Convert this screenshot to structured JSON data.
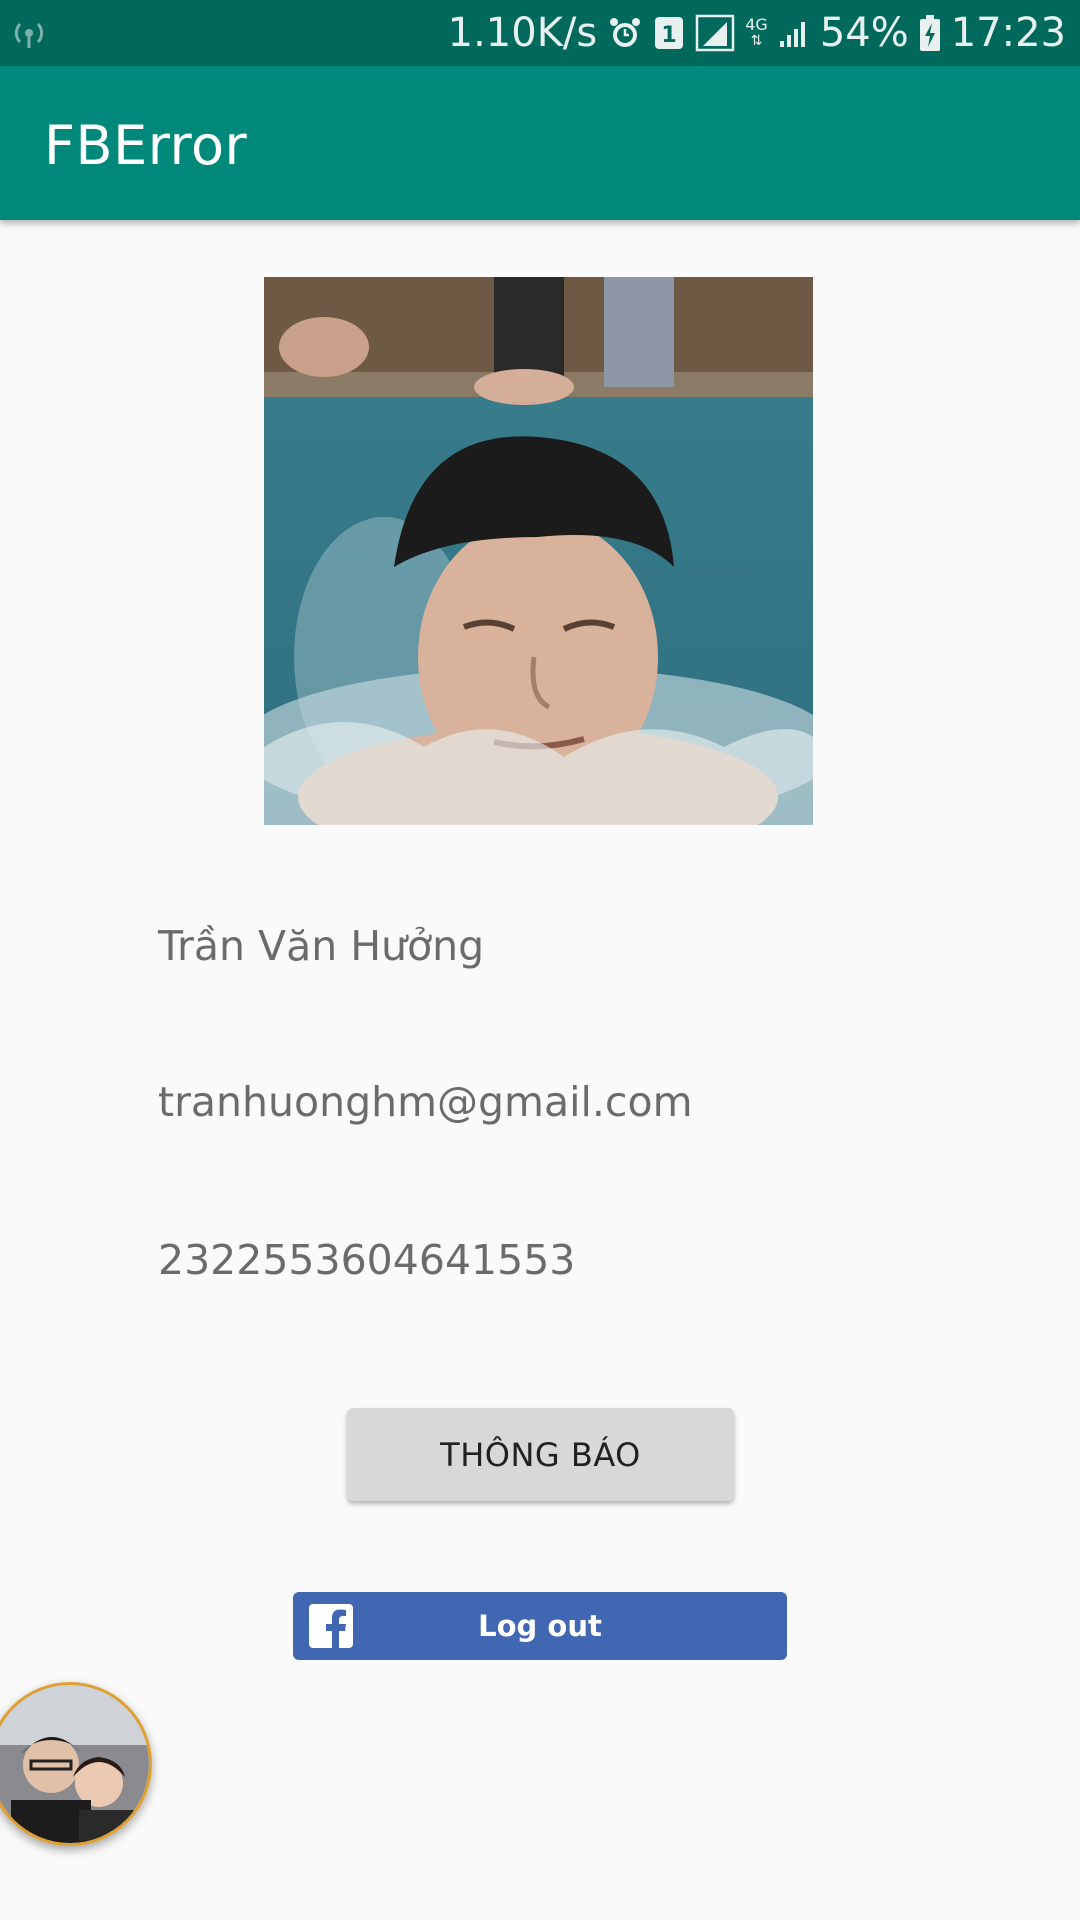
{
  "status_bar": {
    "net_speed": "1.10K/s",
    "sim_badge": "1",
    "network_type": "4G",
    "battery": "54%",
    "time": "17:23",
    "icons": [
      "signal-wifi-icon",
      "alarm-icon",
      "sim-icon",
      "signal-icon",
      "4g-icon",
      "signal-icon",
      "battery-charging-icon"
    ]
  },
  "app_bar": {
    "title": "FBError"
  },
  "profile": {
    "photo": "profile-photo",
    "name": "Trần Văn Hưởng",
    "email": "tranhuonghm@gmail.com",
    "id": "2322553604641553"
  },
  "actions": {
    "notify_label": "THÔNG BÁO",
    "logout_label": "Log out"
  },
  "colors": {
    "status_bar": "#00695c",
    "app_bar": "#00897b",
    "facebook_blue": "#4267b2",
    "background": "#fafafa"
  }
}
